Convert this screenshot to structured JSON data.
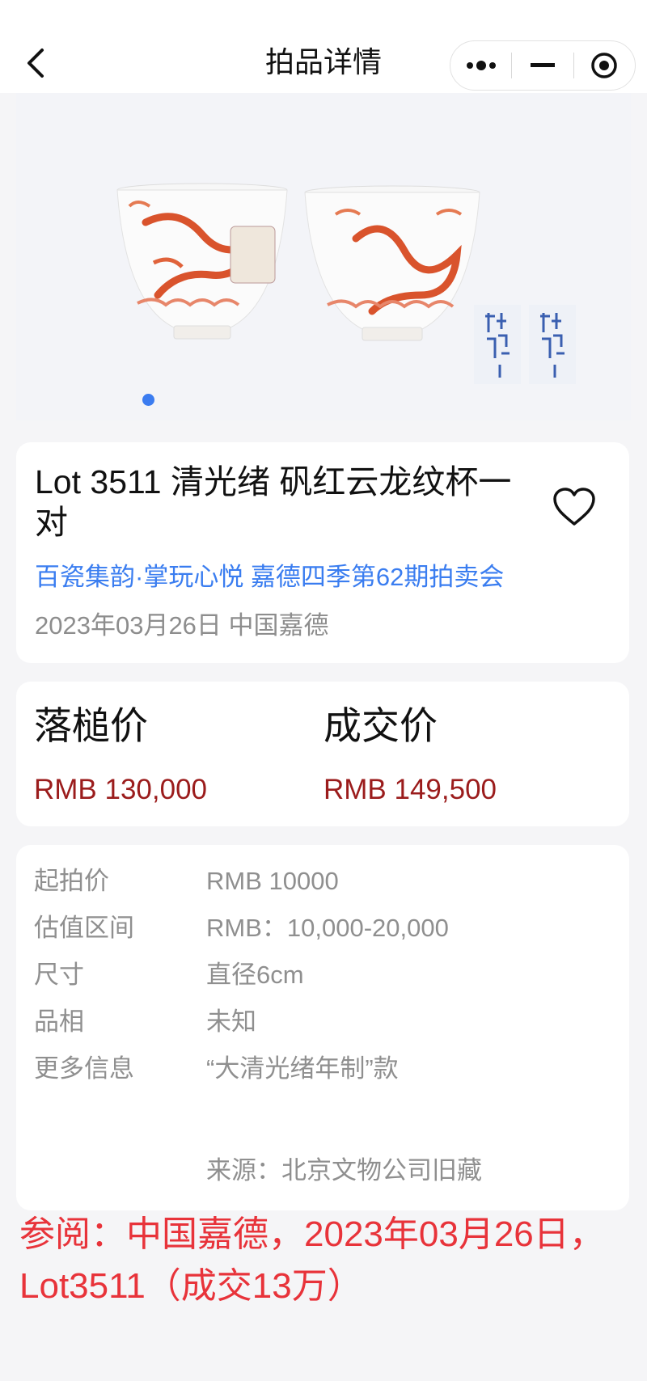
{
  "nav": {
    "title": "拍品详情"
  },
  "gallery": {
    "images": [
      "清光绪 矾红云龙纹杯一对"
    ],
    "active_index": 0
  },
  "lot": {
    "title": "Lot 3511 清光绪 矾红云龙纹杯一对",
    "auction_name": "百瓷集韵·掌玩心悦 嘉德四季第62期拍卖会",
    "date_house": "2023年03月26日 中国嘉德"
  },
  "prices": {
    "hammer": {
      "label": "落槌价",
      "value": "RMB 130,000"
    },
    "sold": {
      "label": "成交价",
      "value": "RMB 149,500"
    }
  },
  "details": [
    {
      "key": "起拍价",
      "value": "RMB 10000"
    },
    {
      "key": "估值区间",
      "value": "RMB：10,000-20,000"
    },
    {
      "key": "尺寸",
      "value": "直径6cm"
    },
    {
      "key": "品相",
      "value": "未知"
    },
    {
      "key": "更多信息",
      "value": "“大清光绪年制”款\n\n\n来源：北京文物公司旧藏"
    }
  ],
  "note": "参阅：中国嘉德，2023年03月26日，Lot3511（成交13万）",
  "colors": {
    "link": "#3a7df0",
    "price": "#9b1c1c",
    "note": "#e8333a",
    "dot": "#3b7cf0"
  }
}
